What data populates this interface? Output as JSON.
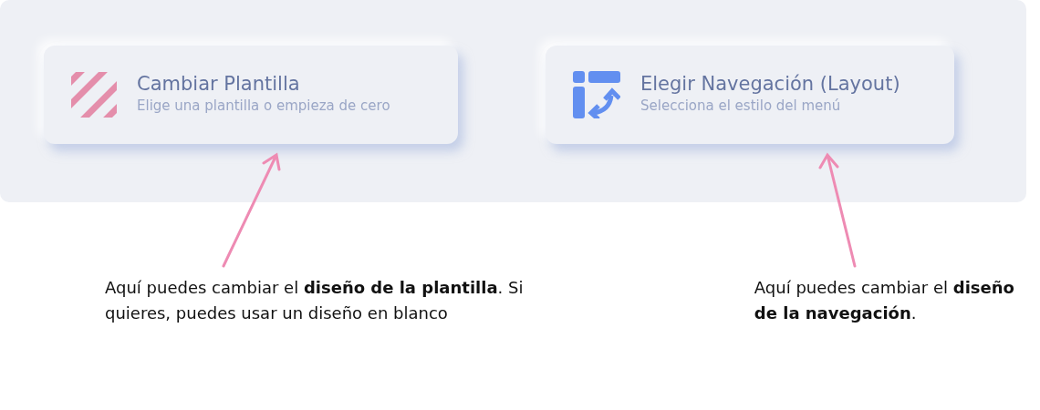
{
  "cards": [
    {
      "title": "Cambiar Plantilla",
      "subtitle": "Elige una plantilla o empieza de cero"
    },
    {
      "title": "Elegir Navegación (Layout)",
      "subtitle": "Selecciona el estilo del menú"
    }
  ],
  "annotations": [
    {
      "text": "Aquí puedes cambiar el **diseño de la plantilla**. Si quieres, puedes usar un diseño en blanco"
    },
    {
      "text": "Aquí puedes cambiar el **diseño de la navegación**."
    }
  ]
}
